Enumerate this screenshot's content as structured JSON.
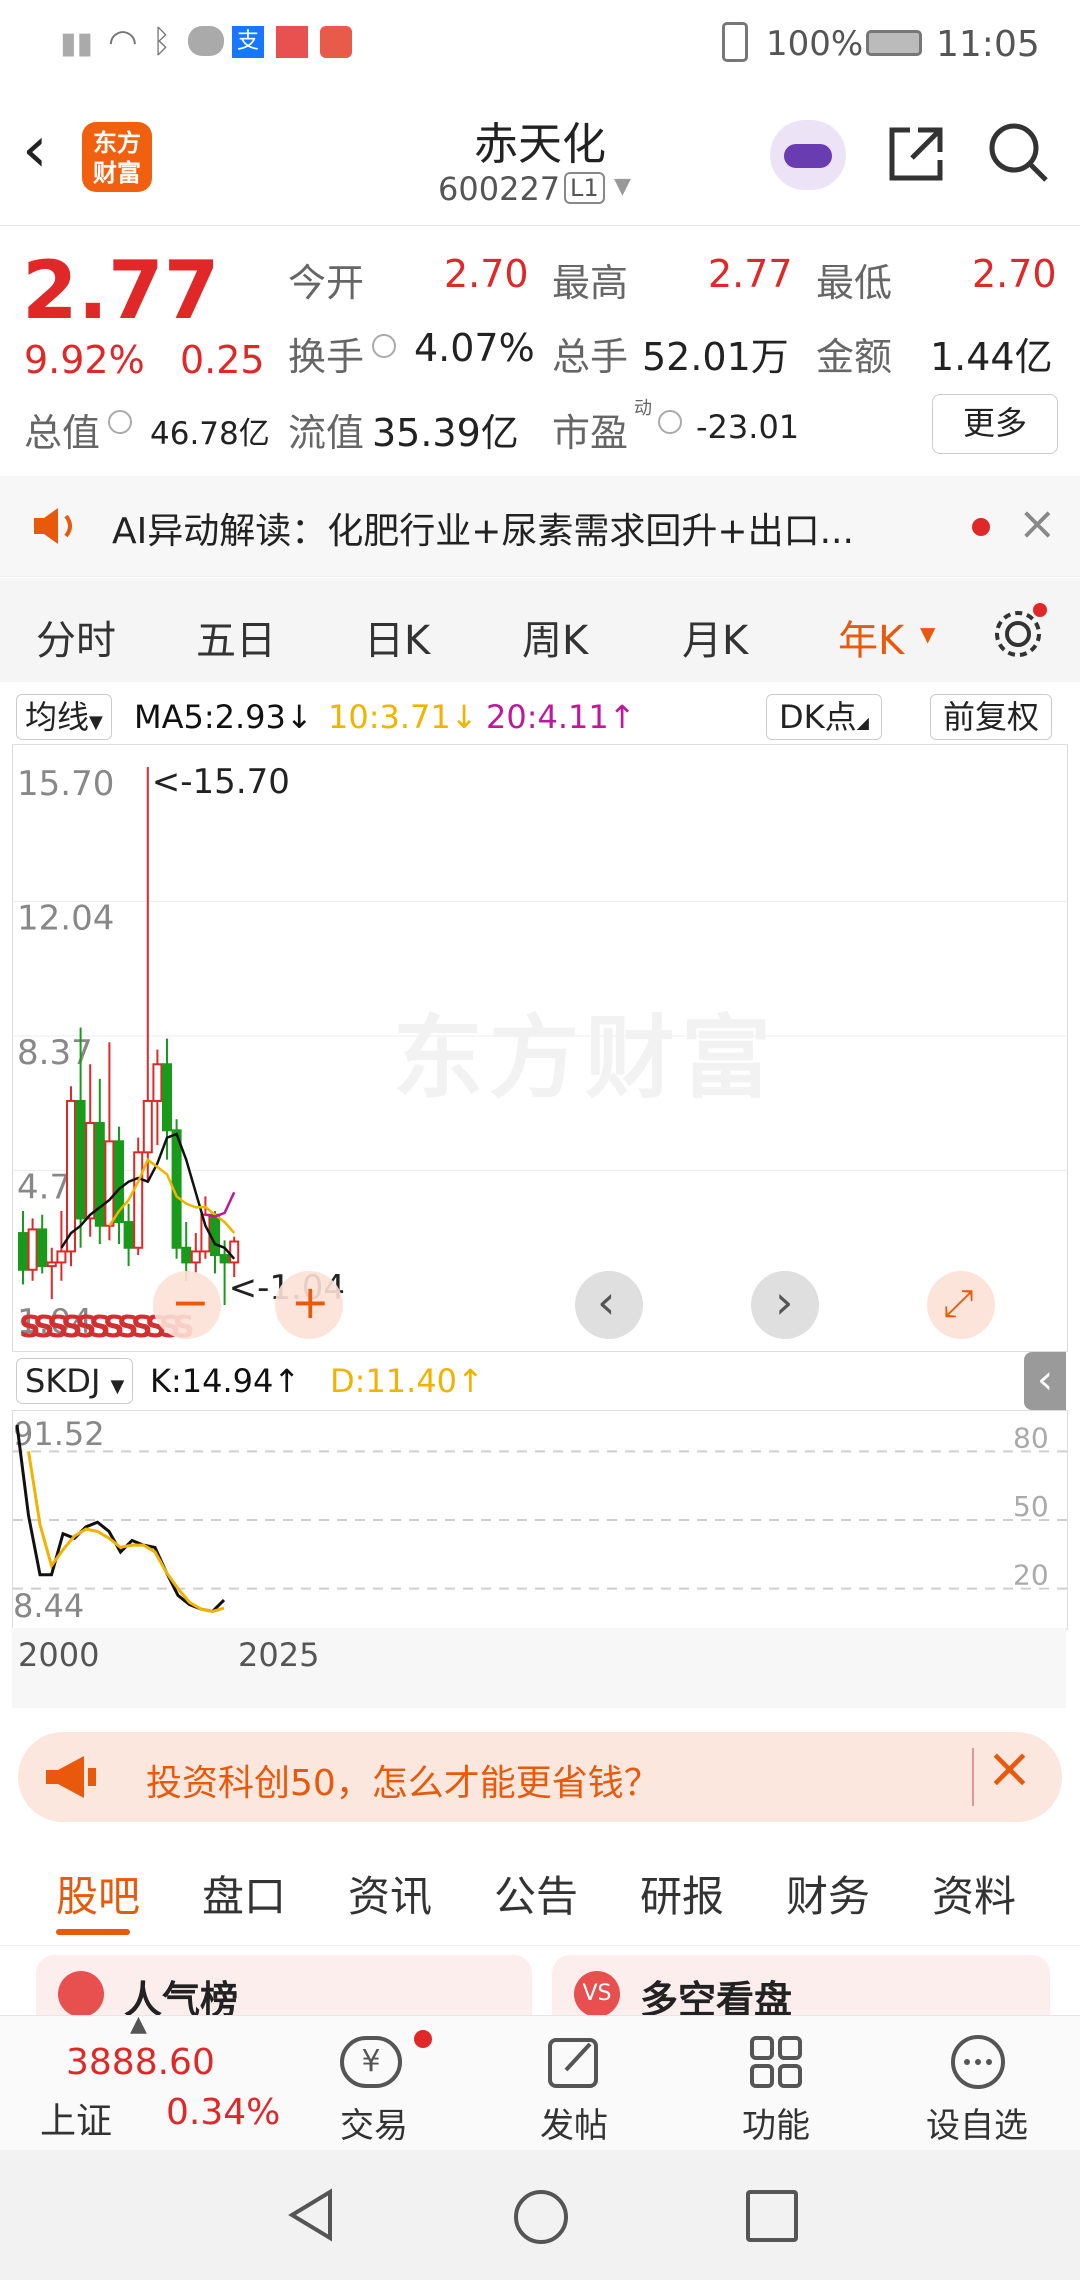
{
  "status": {
    "battery": "100%",
    "time": "11:05"
  },
  "header": {
    "title": "赤天化",
    "code": "600227",
    "level": "L1",
    "logo_text": "东方\n财富"
  },
  "quote": {
    "price": "2.77",
    "change_pct": "9.92%",
    "change": "0.25",
    "open_label": "今开",
    "open": "2.70",
    "high_label": "最高",
    "high": "2.77",
    "low_label": "最低",
    "low": "2.70",
    "turnover_label": "换手",
    "turnover": "4.07%",
    "volume_label": "总手",
    "volume": "52.01万",
    "amount_label": "金额",
    "amount": "1.44亿",
    "mcap_label": "总值",
    "mcap": "46.78亿",
    "float_label": "流值",
    "float": "35.39亿",
    "pe_label": "市盈",
    "pe_sup": "动",
    "pe": "-23.01",
    "more_label": "更多"
  },
  "ai": {
    "text": "AI异动解读：化肥行业+尿素需求回升+出口..."
  },
  "period_tabs": [
    {
      "label": "分时"
    },
    {
      "label": "五日"
    },
    {
      "label": "日K"
    },
    {
      "label": "周K"
    },
    {
      "label": "月K"
    },
    {
      "label": "年K"
    }
  ],
  "ma_bar": {
    "dropdown": "均线",
    "ma5": "MA5:2.93",
    "ma10": "10:3.71",
    "ma20": "20:4.11",
    "dk": "DK点",
    "adjust": "前复权"
  },
  "chart_data": [
    {
      "type": "candlestick",
      "y_ticks": [
        "15.70",
        "12.04",
        "8.37",
        "4.71",
        "1.04"
      ],
      "ylim": [
        1.04,
        15.7
      ],
      "high_annotation": "<-15.70",
      "low_annotation": "<-1.04",
      "candles": [
        {
          "o": 3.0,
          "c": 2.0,
          "h": 3.6,
          "l": 1.6
        },
        {
          "o": 2.0,
          "c": 3.1,
          "h": 3.4,
          "l": 1.7
        },
        {
          "o": 3.1,
          "c": 2.1,
          "h": 3.5,
          "l": 1.9
        },
        {
          "o": 2.1,
          "c": 2.2,
          "h": 2.6,
          "l": 1.2
        },
        {
          "o": 2.2,
          "c": 2.5,
          "h": 3.6,
          "l": 1.7
        },
        {
          "o": 2.5,
          "c": 6.6,
          "h": 7.0,
          "l": 2.1
        },
        {
          "o": 6.6,
          "c": 3.4,
          "h": 8.6,
          "l": 2.6
        },
        {
          "o": 3.4,
          "c": 6.0,
          "h": 7.6,
          "l": 2.9
        },
        {
          "o": 6.0,
          "c": 3.2,
          "h": 7.2,
          "l": 2.7
        },
        {
          "o": 3.2,
          "c": 5.5,
          "h": 8.2,
          "l": 2.8
        },
        {
          "o": 5.5,
          "c": 3.3,
          "h": 5.9,
          "l": 2.7
        },
        {
          "o": 3.3,
          "c": 2.6,
          "h": 3.8,
          "l": 2.1
        },
        {
          "o": 2.6,
          "c": 5.2,
          "h": 5.6,
          "l": 2.4
        },
        {
          "o": 5.2,
          "c": 6.6,
          "h": 15.7,
          "l": 4.4
        },
        {
          "o": 6.6,
          "c": 7.6,
          "h": 8.0,
          "l": 5.4
        },
        {
          "o": 7.6,
          "c": 5.8,
          "h": 8.3,
          "l": 5.0
        },
        {
          "o": 5.8,
          "c": 2.6,
          "h": 6.1,
          "l": 2.3
        },
        {
          "o": 2.6,
          "c": 2.2,
          "h": 3.3,
          "l": 1.7
        },
        {
          "o": 2.2,
          "c": 2.5,
          "h": 3.0,
          "l": 1.9
        },
        {
          "o": 2.5,
          "c": 3.5,
          "h": 4.0,
          "l": 2.3
        },
        {
          "o": 3.5,
          "c": 2.4,
          "h": 3.6,
          "l": 1.9
        },
        {
          "o": 2.4,
          "c": 2.2,
          "h": 2.8,
          "l": 1.04
        },
        {
          "o": 2.2,
          "c": 2.77,
          "h": 2.9,
          "l": 1.8
        }
      ],
      "ma_lines": [
        {
          "name": "MA5",
          "color": "#111111",
          "start": 4,
          "values": [
            2.6,
            3.0,
            3.2,
            3.5,
            3.7,
            3.9,
            4.2,
            4.4,
            4.5,
            4.4,
            4.9,
            5.6,
            5.7,
            5.0,
            4.1,
            3.2,
            2.7,
            2.6,
            2.3
          ]
        },
        {
          "name": "MA10",
          "color": "#f0b400",
          "start": 9,
          "values": [
            3.2,
            3.6,
            3.9,
            4.4,
            5.0,
            4.8,
            4.6,
            4.0,
            3.8,
            3.7,
            3.71,
            3.5,
            3.3,
            3.0
          ]
        },
        {
          "name": "MA20",
          "color": "#c0189a",
          "start": 19,
          "values": [
            3.5,
            3.45,
            3.55,
            4.11
          ]
        }
      ]
    },
    {
      "type": "line",
      "title": "SKDJ",
      "k_label": "K:14.94",
      "d_label": "D:11.40",
      "y_ticks_left": [
        "91.52",
        "8.44"
      ],
      "y_ticks_right": [
        "80",
        "50",
        "20"
      ],
      "ylim": [
        8.44,
        91.52
      ],
      "x_ticks": [
        "2000",
        "2025"
      ],
      "series": [
        {
          "name": "K",
          "color": "#111111",
          "values": [
            91.5,
            52,
            26,
            26,
            44,
            42,
            47,
            49,
            45,
            36,
            41,
            39,
            38,
            27,
            17,
            13,
            11,
            10,
            14.94
          ]
        },
        {
          "name": "D",
          "color": "#f0b400",
          "values": [
            null,
            80,
            48,
            30,
            37,
            43,
            46,
            45,
            42,
            38,
            39,
            39,
            36,
            27,
            20,
            14,
            11,
            10,
            11.4
          ]
        }
      ]
    }
  ],
  "ad": {
    "text": "投资科创50，怎么才能更省钱？"
  },
  "content_tabs": [
    {
      "label": "股吧"
    },
    {
      "label": "盘口"
    },
    {
      "label": "资讯"
    },
    {
      "label": "公告"
    },
    {
      "label": "研报"
    },
    {
      "label": "财务"
    },
    {
      "label": "资料"
    }
  ],
  "cards": [
    {
      "title": "人气榜"
    },
    {
      "title": "多空看盘"
    }
  ],
  "bottom_nav": {
    "index_value": "3888.60",
    "index_name": "上证",
    "index_change": "0.34%",
    "trade": "交易",
    "post": "发帖",
    "functions": "功能",
    "watch": "设自选"
  },
  "colors": {
    "up": "#e02828",
    "down": "#1a9a1a",
    "accent": "#e8590c"
  }
}
